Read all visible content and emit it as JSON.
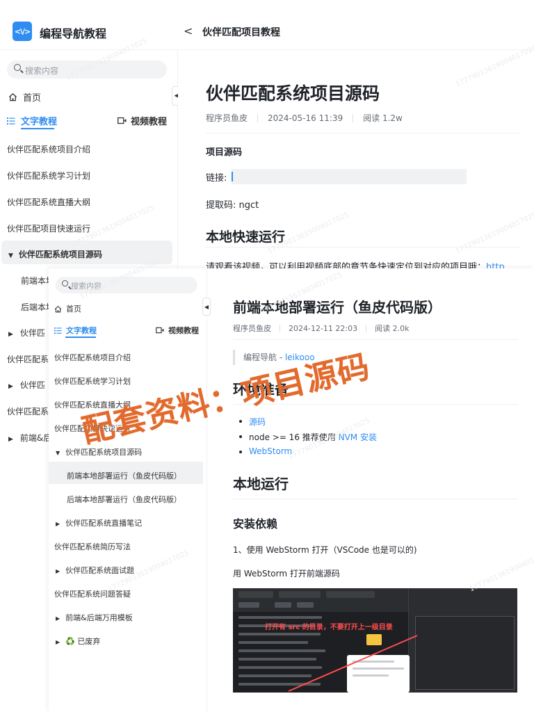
{
  "app": {
    "brand_icon": "<\\/>",
    "brand": "编程导航教程",
    "back_glyph": "<",
    "top_title": "伙伴匹配项目教程"
  },
  "sidebar": {
    "search_placeholder": "搜索内容",
    "home": "首页",
    "tab_text": "文字教程",
    "tab_video": "视频教程",
    "items": [
      "伙伴匹配系统项目介绍",
      "伙伴匹配系统学习计划",
      "伙伴匹配系统直播大纲",
      "伙伴匹配项目快速运行",
      "伙伴匹配系统项目源码",
      "前端本地",
      "后端本地",
      "伙伴匹",
      "伙伴匹配系",
      "伙伴匹",
      "伙伴匹配系",
      "前端&后"
    ]
  },
  "article": {
    "title": "伙伴匹配系统项目源码",
    "author": "程序员鱼皮",
    "date": "2024-05-16 11:39",
    "reads": "阅读 1.2w",
    "section_title": "项目源码",
    "link_label": "链接:",
    "code_label": "提取码: ngct",
    "h2": "本地快速运行",
    "cut_line_text": "请观看该视频，可以利用视频底部的章节条快速定位到对应的项目哦：",
    "cut_line_link": "http"
  },
  "overlay": {
    "search_placeholder": "搜索内容",
    "home": "首页",
    "tab_text": "文字教程",
    "tab_video": "视频教程",
    "items": [
      "伙伴匹配系统项目介绍",
      "伙伴匹配系统学习计划",
      "伙伴匹配系统直播大纲",
      "伙伴匹配项目快速运行",
      "伙伴匹配系统项目源码",
      "前端本地部署运行（鱼皮代码版）",
      "后端本地部署运行（鱼皮代码版）",
      "伙伴匹配系统直播笔记",
      "伙伴匹配系统简历写法",
      "伙伴匹配系统面试题",
      "伙伴匹配系统问题答疑",
      "前端&后端万用模板",
      "♻️ 已废弃"
    ],
    "article": {
      "title": "前端本地部署运行（鱼皮代码版）",
      "author": "程序员鱼皮",
      "date": "2024-12-11 22:03",
      "reads": "阅读 2.0k",
      "quote_prefix": "编程导航 - ",
      "quote_link": "leikooo",
      "h2_env": "环境准备",
      "li_source": "源码",
      "li_node_prefix": "node >= 16 推荐使用 ",
      "li_node_link": "NVM 安装",
      "li_webstorm": "WebStorm",
      "h2_run": "本地运行",
      "h3_install": "安装依赖",
      "p1": "1、使用 WebStorm 打开（VSCode 也是可以的)",
      "p2": "用 WebStorm 打开前端源码",
      "ide_note": "打开有 src 的目录，不要打开上一级目录"
    }
  },
  "promo": "配套资料：项目源码",
  "watermark": "17779013619004017025",
  "colors": {
    "accent": "#2f8cf0",
    "promo": "#e26a2c"
  },
  "icons": [
    "code-logo-icon",
    "chevron-left-icon",
    "search-icon",
    "home-icon",
    "list-icon",
    "video-icon",
    "caret-down-icon",
    "caret-right-icon",
    "collapse-icon"
  ]
}
